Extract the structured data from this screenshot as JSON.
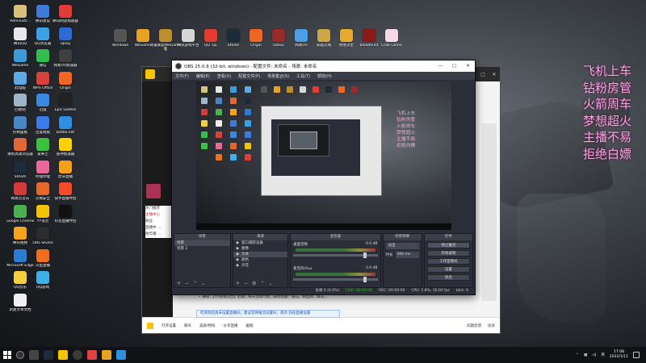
{
  "desktop": {
    "icons": [
      {
        "label": "Administr...",
        "color": "#d6c27a",
        "col": 0,
        "row": 0
      },
      {
        "label": "腾讯QQ",
        "color": "#e8e8e8",
        "col": 0,
        "row": 1
      },
      {
        "label": "WeGame",
        "color": "#3a9bd6",
        "col": 0,
        "row": 2
      },
      {
        "label": "此电脑",
        "color": "#5fa8e6",
        "col": 0,
        "row": 3
      },
      {
        "label": "回收站",
        "color": "#9fb6c8",
        "col": 0,
        "row": 4
      },
      {
        "label": "控制面板",
        "color": "#4a86c6",
        "col": 0,
        "row": 5
      },
      {
        "label": "搜狗高速浏览器",
        "color": "#e0673a",
        "col": 0,
        "row": 6
      },
      {
        "label": "Steam",
        "color": "#1e2b3a",
        "col": 0,
        "row": 7
      },
      {
        "label": "网易云音乐",
        "color": "#d33a3a",
        "col": 0,
        "row": 8
      },
      {
        "label": "Google Chrome",
        "color": "#4caf50",
        "col": 0,
        "row": 9
      },
      {
        "label": "腾讯视频",
        "color": "#f7a21b",
        "col": 0,
        "row": 10
      },
      {
        "label": "Microsoft Edge",
        "color": "#2b7cd3",
        "col": 0,
        "row": 11
      },
      {
        "label": "QQ音乐",
        "color": "#f4d03f",
        "col": 0,
        "row": 12
      },
      {
        "label": "新建文本文档",
        "color": "#f0f0f0",
        "col": 0,
        "row": 13
      },
      {
        "label": "腾讯会议",
        "color": "#3d7bd9",
        "col": 1,
        "row": 0
      },
      {
        "label": "QQ浏览器",
        "color": "#3aa0e8",
        "col": 1,
        "row": 1
      },
      {
        "label": "微信",
        "color": "#2fbf4f",
        "col": 1,
        "row": 2
      },
      {
        "label": "WPS Office",
        "color": "#d7423a",
        "col": 1,
        "row": 3
      },
      {
        "label": "迅雷",
        "color": "#3a88e0",
        "col": 1,
        "row": 4
      },
      {
        "label": "百度网盘",
        "color": "#3a7be8",
        "col": 1,
        "row": 5
      },
      {
        "label": "爱奇艺",
        "color": "#3fbf3f",
        "col": 1,
        "row": 6
      },
      {
        "label": "哔哩哔哩",
        "color": "#e96a9a",
        "col": 1,
        "row": 7
      },
      {
        "label": "火绒安全",
        "color": "#e5672a",
        "col": 1,
        "row": 8
      },
      {
        "label": "YY语音",
        "color": "#f5c400",
        "col": 1,
        "row": 9
      },
      {
        "label": "OBS Studio",
        "color": "#2c2c2c",
        "col": 1,
        "row": 10
      },
      {
        "label": "斗鱼直播",
        "color": "#ef6f1c",
        "col": 1,
        "row": 11
      },
      {
        "label": "QQ游戏",
        "color": "#3db0e8",
        "col": 1,
        "row": 12
      },
      {
        "label": "腾讯网游加速器",
        "color": "#e33a3a",
        "col": 2,
        "row": 0
      },
      {
        "label": "Uplay",
        "color": "#2e6ad3",
        "col": 2,
        "row": 1
      },
      {
        "label": "网易UU加速器",
        "color": "#3f3f3f",
        "col": 2,
        "row": 2
      },
      {
        "label": "Origin",
        "color": "#f26522",
        "col": 2,
        "row": 3
      },
      {
        "label": "Epic Games",
        "color": "#222222",
        "col": 2,
        "row": 4
      },
      {
        "label": "Battle.net",
        "color": "#2f8ee0",
        "col": 2,
        "row": 5
      },
      {
        "label": "雷神加速器",
        "color": "#ffd200",
        "col": 2,
        "row": 6
      },
      {
        "label": "虎牙直播",
        "color": "#f6a01a",
        "col": 2,
        "row": 7
      },
      {
        "label": "快手直播伴侣",
        "color": "#f34a2a",
        "col": 2,
        "row": 8
      },
      {
        "label": "抖音直播伴侣",
        "color": "#111111",
        "col": 2,
        "row": 9
      }
    ],
    "top_icons": [
      {
        "label": "Windows",
        "color": "#555"
      },
      {
        "label": "WeGame",
        "color": "#e6a323"
      },
      {
        "label": "英雄联盟WeGame版",
        "color": "#bd8e2d"
      },
      {
        "label": "腾讯游戏平台",
        "color": "#d6d6d6"
      },
      {
        "label": "QQ飞车",
        "color": "#e43c2e"
      },
      {
        "label": "Steam",
        "color": "#1d2a38"
      },
      {
        "label": "Origin",
        "color": "#f26522"
      },
      {
        "label": "Dota2",
        "color": "#9a2a2a"
      },
      {
        "label": "网易UU",
        "color": "#4aa0e6"
      },
      {
        "label": "穿越火线",
        "color": "#caa64a"
      },
      {
        "label": "绝地求生",
        "color": "#e4a92e"
      },
      {
        "label": "Bloodhunt",
        "color": "#8a1a1a"
      },
      {
        "label": "Crab Game",
        "color": "#f5d7e6"
      }
    ]
  },
  "overlay_lines": [
    "飞机上车",
    "钻粉房管",
    "火箭周车",
    "梦想超火",
    "主播不易",
    "拒绝白嫖"
  ],
  "back_app": {
    "list_items": [
      "热门推荐",
      "主播中心",
      "粉丝",
      "直播中 ...",
      "防炸播 ..."
    ],
    "ticker": "• 通知：【YY游戏公告】近期...每天活动介绍...获得奖励：钻石、粉丝牌、鲜花...",
    "notice": "检测到您尚未设置直播间，建议您将推流设置好，或点 前往直播设置",
    "status_left": [
      "打开设置",
      "聊天",
      "美颜/特效",
      "分享直播",
      "截图",
      "录像"
    ],
    "status_right": [
      "问题反馈",
      "投诉"
    ]
  },
  "obs": {
    "title": "OBS 25.0.8 (32-bit, windows) - 配置文件: 未命名 - 场景: 未命名",
    "menu": [
      "文件(F)",
      "编辑(E)",
      "查看(V)",
      "配置文件(P)",
      "场景集合(S)",
      "工具(T)",
      "帮助(H)"
    ],
    "window_controls": [
      "—",
      "□",
      "✕"
    ],
    "docks": {
      "scenes": {
        "title": "场景",
        "items": [
          "场景",
          "场景 2"
        ]
      },
      "sources": {
        "title": "来源",
        "items": [
          "窗口捕获设备",
          "图像",
          "文本",
          "颜色",
          "声音"
        ]
      },
      "mixer": {
        "title": "混音器",
        "channels": [
          {
            "name": "桌面音频",
            "db": "0.0 dB"
          },
          {
            "name": "麦克风/Aux",
            "db": "0.0 dB"
          }
        ]
      },
      "transitions": {
        "title": "场景转换",
        "type": "淡出",
        "duration_label": "时长",
        "duration": "300 ms"
      },
      "controls": {
        "title": "控件",
        "buttons": [
          "停止推流",
          "开始录制",
          "工作室模式",
          "设置",
          "退出"
        ]
      }
    },
    "status": {
      "live": "LIVE: 00:00:00",
      "rec": "REC: 00:00:00",
      "cpu": "CPU: 1.8%, 30.00 fps",
      "drop": "丢帧 0 (0.0%)",
      "kbps": "kb/s: 0"
    }
  },
  "taskbar": {
    "time": "17:08",
    "date": "2022/1/11",
    "lang": "英"
  }
}
